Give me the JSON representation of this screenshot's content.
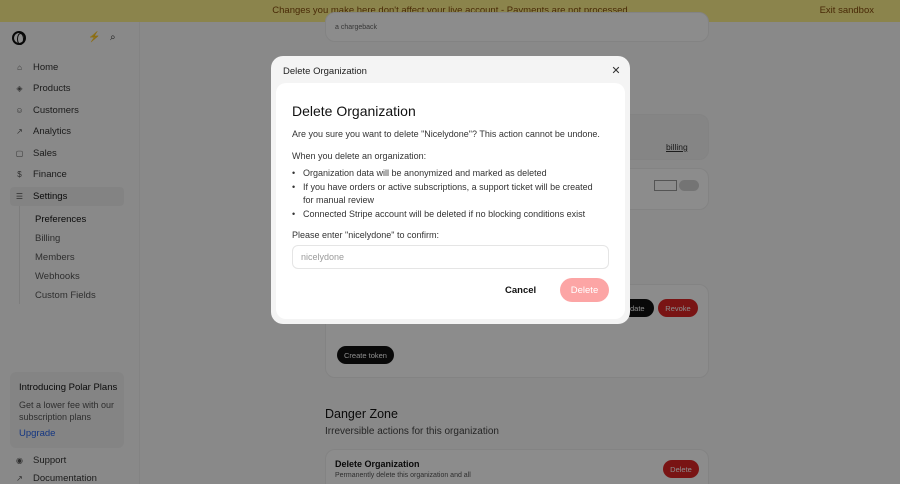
{
  "banner": {
    "message": "Changes you make here don't affect your live account - Payments are not processed",
    "exit_label": "Exit sandbox"
  },
  "sidebar": {
    "nav": [
      {
        "label": "Home",
        "icon": "home-icon"
      },
      {
        "label": "Products",
        "icon": "products-icon"
      },
      {
        "label": "Customers",
        "icon": "customers-icon"
      },
      {
        "label": "Analytics",
        "icon": "analytics-icon"
      },
      {
        "label": "Sales",
        "icon": "sales-icon"
      },
      {
        "label": "Finance",
        "icon": "finance-icon"
      },
      {
        "label": "Settings",
        "icon": "settings-icon"
      }
    ],
    "subnav": [
      "Preferences",
      "Billing",
      "Members",
      "Webhooks",
      "Custom Fields"
    ],
    "promo": {
      "title": "Introducing Polar Plans",
      "body": "Get a lower fee with our subscription plans",
      "link": "Upgrade"
    },
    "bottom": [
      {
        "label": "Support",
        "icon": "support-icon"
      },
      {
        "label": "Documentation",
        "icon": "documentation-icon"
      }
    ]
  },
  "background": {
    "chargeback_text": "a chargeback",
    "billing_link": "billing",
    "update_button": "Update",
    "revoke_button": "Revoke",
    "create_token_button": "Create token",
    "danger_zone": {
      "heading": "Danger Zone",
      "subheading": "Irreversible actions for this organization",
      "card_title": "Delete Organization",
      "card_desc": "Permanently delete this organization and all",
      "delete_button": "Delete"
    }
  },
  "dialog": {
    "header_title": "Delete Organization",
    "title": "Delete Organization",
    "confirm_text": "Are you sure you want to delete \"Nicelydone\"? This action cannot be undone.",
    "when_text": "When you delete an organization:",
    "consequences": [
      "Organization data will be anonymized and marked as deleted",
      "If you have orders or active subscriptions, a support ticket will be created for manual review",
      "Connected Stripe account will be deleted if no blocking conditions exist"
    ],
    "prompt": "Please enter \"nicelydone\" to confirm:",
    "input_placeholder": "nicelydone",
    "cancel_label": "Cancel",
    "delete_label": "Delete"
  },
  "colors": {
    "banner_bg": "#fef08a",
    "danger": "#dc2626",
    "delete_disabled": "#fca5a5",
    "link": "#2563eb"
  }
}
